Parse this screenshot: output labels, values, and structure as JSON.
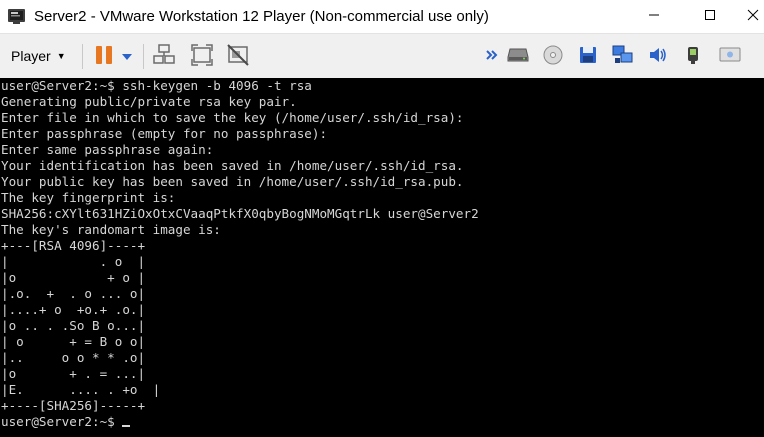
{
  "window": {
    "title": "Server2 - VMware Workstation 12 Player (Non-commercial use only)",
    "controls": {
      "minimize": "minimize-icon",
      "maximize": "maximize-icon",
      "close": "close-icon"
    }
  },
  "toolbar": {
    "player_menu_label": "Player",
    "buttons": [
      "pause-icon",
      "power-dropdown-icon",
      "send-ctrl-alt-del-icon",
      "fit-guest-icon",
      "unity-icon"
    ],
    "devices": [
      "expand-devices-icon",
      "hard-disk-icon",
      "cd-dvd-icon",
      "floppy-icon",
      "network-adapter-icon",
      "sound-card-icon",
      "display-icon"
    ],
    "colors": {
      "pause": "#e87722",
      "accent_blue": "#2a62c9",
      "toolbar_bg": "#f0f0f0"
    }
  },
  "console": {
    "lines": [
      "user@Server2:~$ ssh-keygen -b 4096 -t rsa",
      "Generating public/private rsa key pair.",
      "Enter file in which to save the key (/home/user/.ssh/id_rsa):",
      "Enter passphrase (empty for no passphrase):",
      "Enter same passphrase again:",
      "Your identification has been saved in /home/user/.ssh/id_rsa.",
      "Your public key has been saved in /home/user/.ssh/id_rsa.pub.",
      "The key fingerprint is:",
      "SHA256:cXYlt631HZiOxOtxCVaaqPtkfX0qbyBogNMoMGqtrLk user@Server2",
      "The key's randomart image is:",
      "+---[RSA 4096]----+",
      "|            . o  |",
      "|o            + o |",
      "|.o.  +  . o ... o|",
      "|....+ o  +o.+ .o.|",
      "|o .. . .So B o...|",
      "| o      + = B o o|",
      "|..     o o * * .o|",
      "|o       + . = ...|",
      "|E.      .... . +o  |",
      "+----[SHA256]-----+"
    ],
    "prompt": "user@Server2:~$ ",
    "colors": {
      "background": "#000000",
      "foreground": "#d6d6d6"
    }
  }
}
